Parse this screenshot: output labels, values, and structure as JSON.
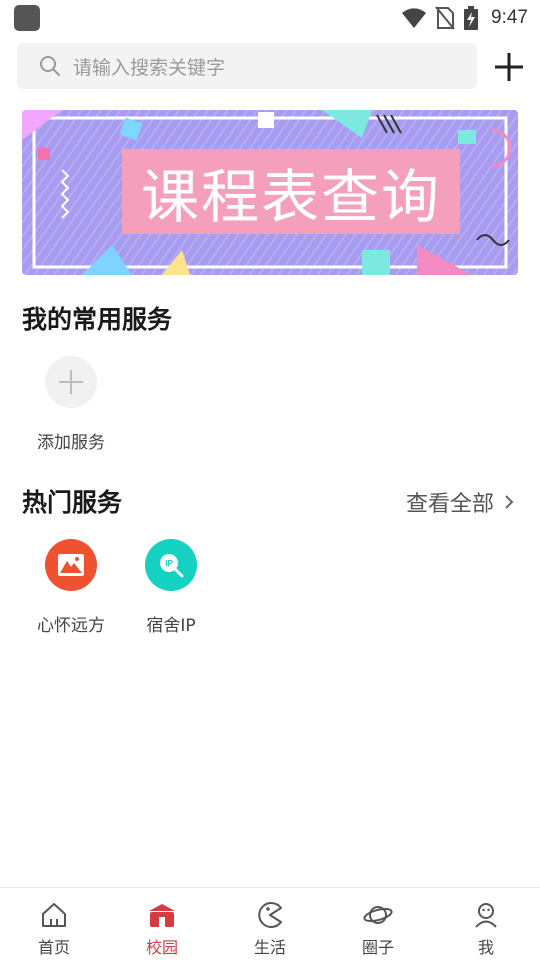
{
  "status_bar": {
    "time": "9:47"
  },
  "search": {
    "placeholder": "请输入搜索关键字"
  },
  "banner": {
    "title": "课程表查询"
  },
  "my_services": {
    "title": "我的常用服务",
    "add_label": "添加服务"
  },
  "hot_services": {
    "title": "热门服务",
    "view_all": "查看全部",
    "items": [
      {
        "label": "心怀远方",
        "color": "#ee5230",
        "icon": "mountain-icon"
      },
      {
        "label": "宿舍IP",
        "color": "#14d1c1",
        "icon": "ip-search-icon"
      }
    ]
  },
  "bottom_nav": {
    "active_color": "#d63b42",
    "items": [
      {
        "label": "首页",
        "icon": "home-icon"
      },
      {
        "label": "校园",
        "icon": "campus-icon"
      },
      {
        "label": "生活",
        "icon": "life-icon"
      },
      {
        "label": "圈子",
        "icon": "planet-icon"
      },
      {
        "label": "我",
        "icon": "user-icon"
      }
    ]
  }
}
